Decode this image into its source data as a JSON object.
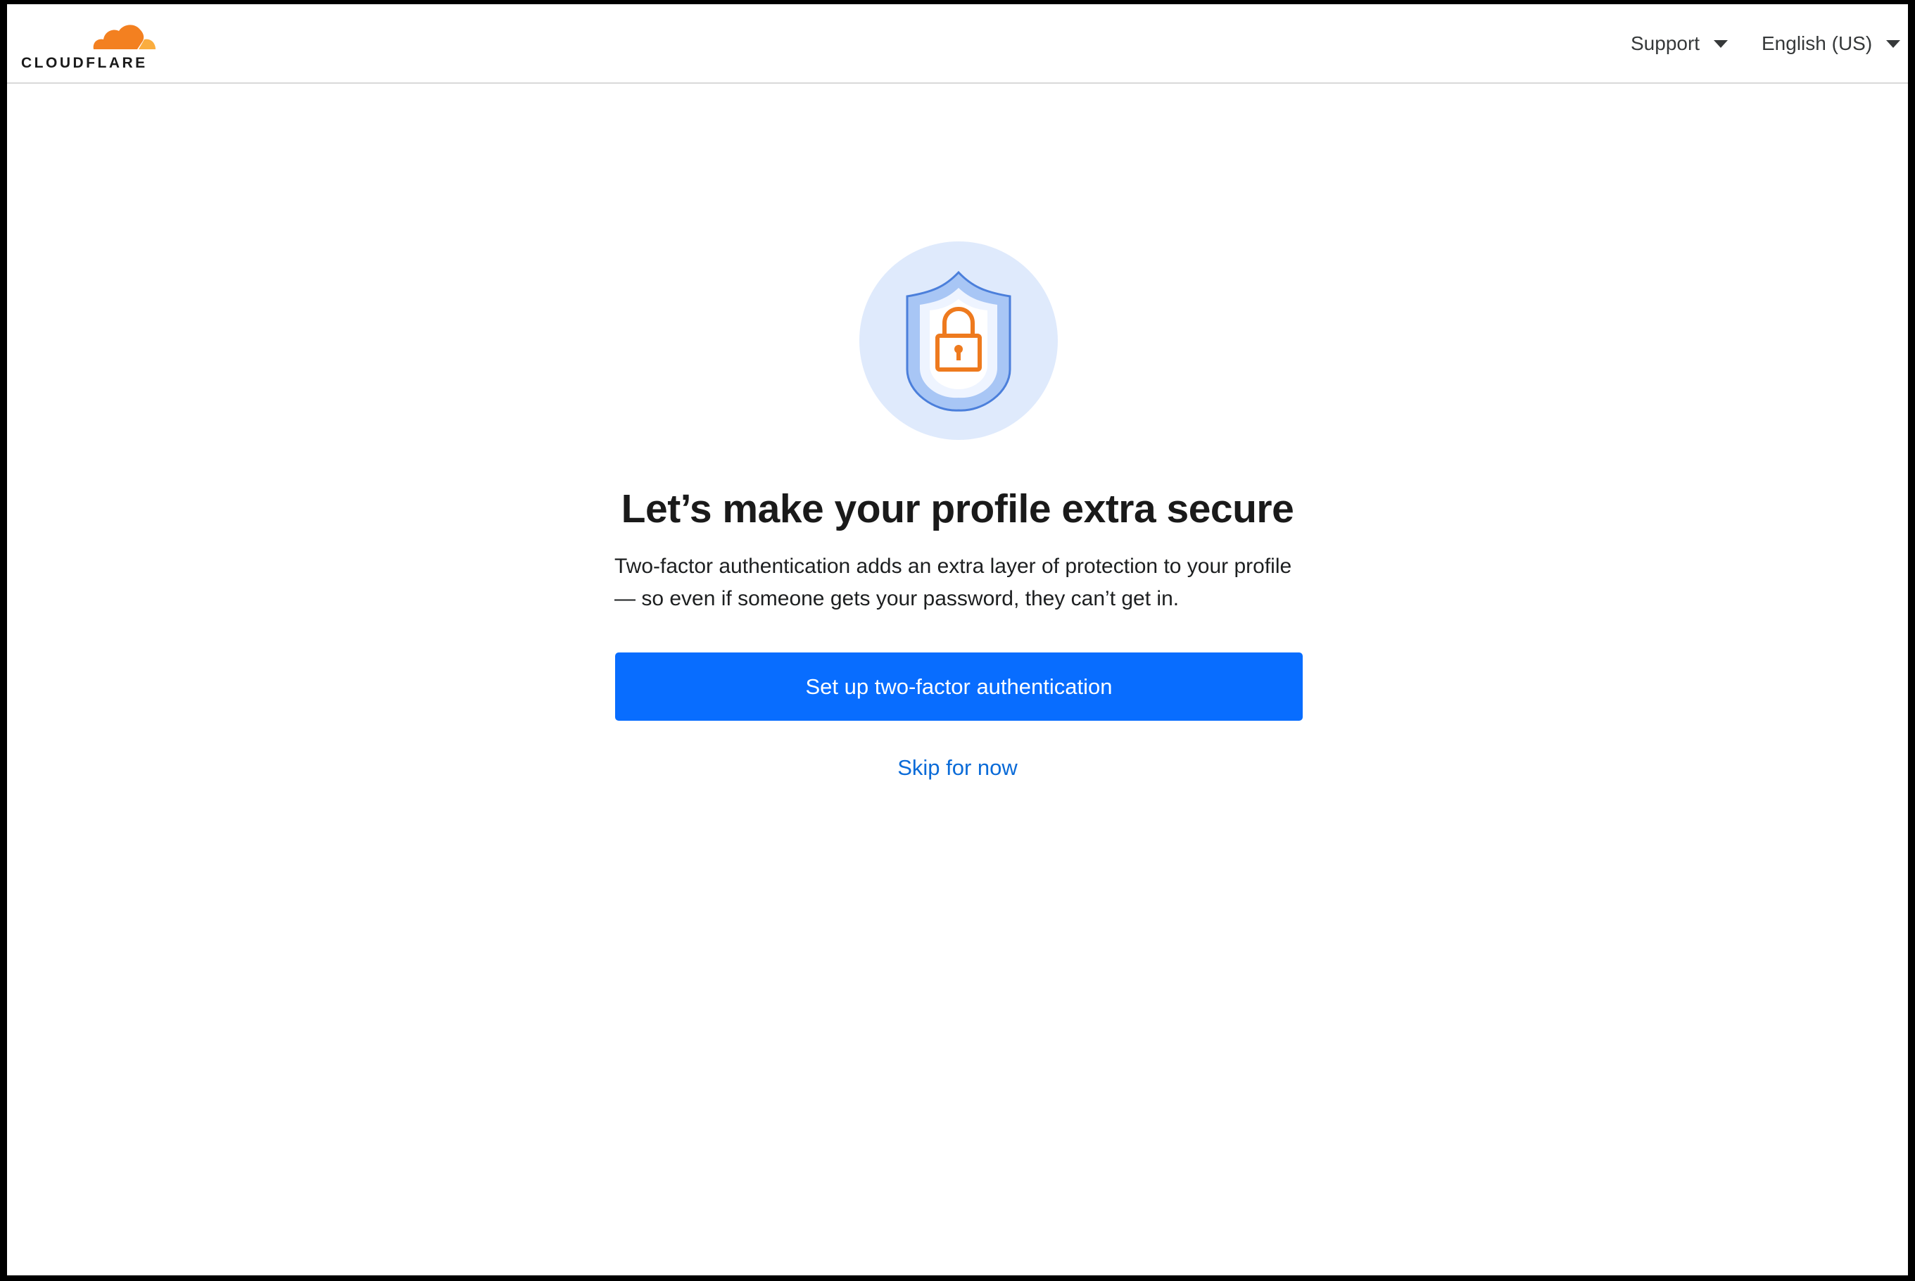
{
  "header": {
    "logo_text": "CLOUDFLARE",
    "support_label": "Support",
    "language_label": "English (US)"
  },
  "main": {
    "headline": "Let’s make your profile extra secure",
    "description": "Two-factor authentication adds an extra layer of protection to your profile — so even if someone gets your password, they can’t get in.",
    "primary_button_label": "Set up two-factor authentication",
    "skip_label": "Skip for now"
  },
  "icons": {
    "brand": "cloudflare-cloud-icon",
    "illustration": "shield-lock-icon",
    "dropdown": "caret-down-icon"
  },
  "colors": {
    "brand_orange": "#f38020",
    "primary_blue": "#086dff",
    "link_blue": "#0a6bd8",
    "illustration_bg": "#dfeafc",
    "shield_blue": "#a8c6f5",
    "lock_orange": "#ee7a1e"
  }
}
